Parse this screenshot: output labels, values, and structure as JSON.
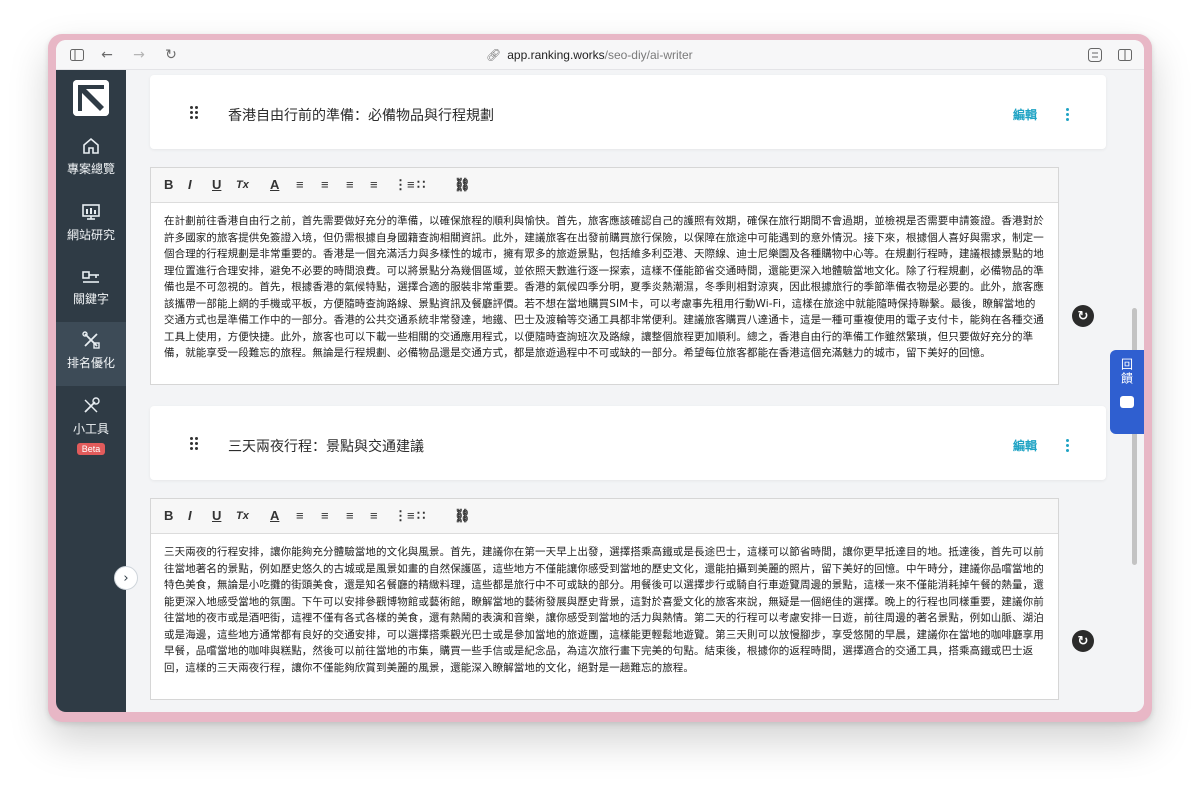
{
  "browser": {
    "url_host": "app.ranking.works",
    "url_path": "/seo-diy/ai-writer"
  },
  "sidebar": {
    "items": [
      {
        "label": "專案總覽",
        "icon": "home-icon"
      },
      {
        "label": "網站研究",
        "icon": "monitor-icon"
      },
      {
        "label": "關鍵字",
        "icon": "key-icon"
      },
      {
        "label": "排名優化",
        "icon": "tools-icon"
      },
      {
        "label": "小工具",
        "icon": "wrench-icon",
        "badge": "Beta"
      }
    ],
    "active_index": 3
  },
  "sections": [
    {
      "title": "香港自由行前的準備：必備物品與行程規劃",
      "edit_label": "編輯",
      "content": "在計劃前往香港自由行之前，首先需要做好充分的準備，以確保旅程的順利與愉快。首先，旅客應該確認自己的護照有效期，確保在旅行期間不會過期，並檢視是否需要申請簽證。香港對於許多國家的旅客提供免簽證入境，但仍需根據自身國籍查詢相關資訊。此外，建議旅客在出發前購買旅行保險，以保障在旅途中可能遇到的意外情況。接下來，根據個人喜好與需求，制定一個合理的行程規劃是非常重要的。香港是一個充滿活力與多樣性的城市，擁有眾多的旅遊景點，包括維多利亞港、天際線、迪士尼樂園及各種購物中心等。在規劃行程時，建議根據景點的地理位置進行合理安排，避免不必要的時間浪費。可以將景點分為幾個區域，並依照天數進行逐一探索，這樣不僅能節省交通時間，還能更深入地體驗當地文化。除了行程規劃，必備物品的準備也是不可忽視的。首先，根據香港的氣候特點，選擇合適的服裝非常重要。香港的氣候四季分明，夏季炎熱潮濕，冬季則相對涼爽，因此根據旅行的季節準備衣物是必要的。此外，旅客應該攜帶一部能上網的手機或平板，方便隨時查詢路線、景點資訊及餐廳評價。若不想在當地購買SIM卡，可以考慮事先租用行動Wi-Fi，這樣在旅途中就能隨時保持聯繫。最後，瞭解當地的交通方式也是準備工作中的一部分。香港的公共交通系統非常發達，地鐵、巴士及渡輪等交通工具都非常便利。建議旅客購買八達通卡，這是一種可重複使用的電子支付卡，能夠在各種交通工具上使用，方便快捷。此外，旅客也可以下載一些相關的交通應用程式，以便隨時查詢班次及路線，讓整個旅程更加順利。總之，香港自由行的準備工作雖然繁瑣，但只要做好充分的準備，就能享受一段難忘的旅程。無論是行程規劃、必備物品還是交通方式，都是旅遊過程中不可或缺的一部分。希望每位旅客都能在香港這個充滿魅力的城市，留下美好的回憶。"
    },
    {
      "title": "三天兩夜行程：景點與交通建議",
      "edit_label": "編輯",
      "content": "三天兩夜的行程安排，讓你能夠充分體驗當地的文化與風景。首先，建議你在第一天早上出發，選擇搭乘高鐵或是長途巴士，這樣可以節省時間，讓你更早抵達目的地。抵達後，首先可以前往當地著名的景點，例如歷史悠久的古城或是風景如畫的自然保護區，這些地方不僅能讓你感受到當地的歷史文化，還能拍攝到美麗的照片，留下美好的回憶。中午時分，建議你品嚐當地的特色美食，無論是小吃攤的街頭美食，還是知名餐廳的精緻料理，這些都是旅行中不可或缺的部分。用餐後可以選擇步行或騎自行車遊覽周邊的景點，這樣一來不僅能消耗掉午餐的熱量，還能更深入地感受當地的氛圍。下午可以安排參觀博物館或藝術館，瞭解當地的藝術發展與歷史背景，這對於喜愛文化的旅客來說，無疑是一個絕佳的選擇。晚上的行程也同樣重要，建議你前往當地的夜市或是酒吧街，這裡不僅有各式各樣的美食，還有熱鬧的表演和音樂，讓你感受到當地的活力與熱情。第二天的行程可以考慮安排一日遊，前往周邊的著名景點，例如山脈、湖泊或是海邊，這些地方通常都有良好的交通安排，可以選擇搭乘觀光巴士或是參加當地的旅遊團，這樣能更輕鬆地遊覽。第三天則可以放慢腳步，享受悠閒的早晨，建議你在當地的咖啡廳享用早餐，品嚐當地的咖啡與糕點，然後可以前往當地的市集，購買一些手信或是紀念品，為這次旅行畫下完美的句點。結束後，根據你的返程時間，選擇適合的交通工具，搭乘高鐵或巴士返回，這樣的三天兩夜行程，讓你不僅能夠欣賞到美麗的風景，還能深入瞭解當地的文化，絕對是一趟難忘的旅程。"
    }
  ],
  "toolbar": {
    "bold": "B",
    "italic": "I",
    "underline": "U",
    "clear": "Tx",
    "color": "A"
  },
  "float_tab": {
    "label": "回饋"
  },
  "colors": {
    "sidebar_bg": "#2f3b45",
    "accent": "#1fa3c4",
    "feedback_tab": "#2f5fd0",
    "badge": "#e25b5b"
  }
}
